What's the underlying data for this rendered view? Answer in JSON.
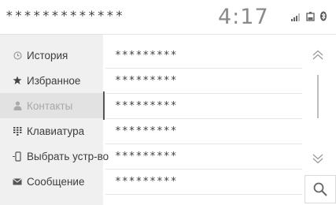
{
  "header": {
    "title": "*************",
    "time": "4:17"
  },
  "sidebar": {
    "items": [
      {
        "label": "История",
        "icon": "clock-icon"
      },
      {
        "label": "Избранное",
        "icon": "star-icon"
      },
      {
        "label": "Контакты",
        "icon": "person-icon",
        "active": true
      },
      {
        "label": "Клавиатура",
        "icon": "keypad-icon"
      },
      {
        "label": "Выбрать устр-во",
        "icon": "phone-device-icon"
      },
      {
        "label": "Сообщение",
        "icon": "envelope-icon"
      }
    ]
  },
  "list": {
    "rows": [
      "*********",
      "*********",
      "*********",
      "*********",
      "*********",
      "*********"
    ]
  },
  "status_icons": [
    "signal-icon",
    "battery-icon",
    "bluetooth-icon"
  ],
  "colors": {
    "background": "#ffffff",
    "sidebar_bg": "#f0f0f0",
    "sidebar_active_bg": "#e2e2e2",
    "text": "#3d3d3d",
    "muted": "#a8a8a8"
  }
}
